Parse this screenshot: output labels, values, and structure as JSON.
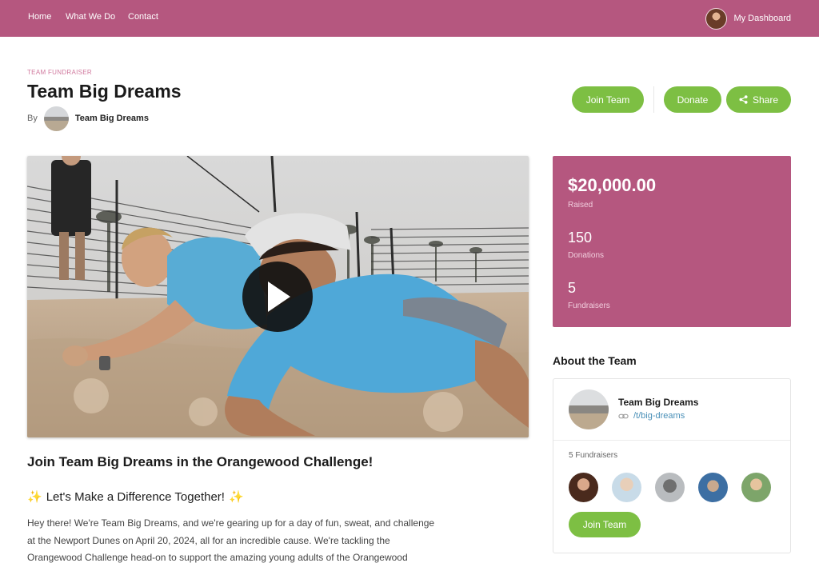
{
  "nav": {
    "links": [
      "Home",
      "What We Do",
      "Contact"
    ],
    "dashboard_label": "My Dashboard"
  },
  "header": {
    "eyebrow": "TEAM FUNDRAISER",
    "title": "Team Big Dreams",
    "by_label": "By",
    "owner_name": "Team Big Dreams"
  },
  "actions": {
    "join_label": "Join Team",
    "donate_label": "Donate",
    "share_label": "Share"
  },
  "stats": {
    "raised_value": "$20,000.00",
    "raised_label": "Raised",
    "donations_value": "150",
    "donations_label": "Donations",
    "fundraisers_value": "5",
    "fundraisers_label": "Fundraisers"
  },
  "about": {
    "heading": "About the Team",
    "team_name": "Team Big Dreams",
    "team_link": "/t/big-dreams",
    "fundraisers_count": "5 Fundraisers",
    "join_label": "Join Team"
  },
  "content": {
    "campaign_title": "Join Team Big Dreams in the Orangewood Challenge!",
    "sub_heading": "Let's Make a Difference Together!",
    "paragraph_lines": [
      "Hey there! We're Team Big Dreams, and we're gearing up for a day of fun, sweat, and challenge",
      "at the Newport Dunes on April 20, 2024, all for an incredible cause. We're tackling the",
      "Orangewood Challenge head-on to support the amazing young adults of the Orangewood"
    ]
  },
  "colors": {
    "brand": "#b5577f",
    "accent_green": "#7dbf43",
    "link": "#4a90b8"
  },
  "icons": {
    "share": "share-icon",
    "play": "play-icon",
    "link": "link-icon",
    "sparkle": "sparkle-icon"
  }
}
